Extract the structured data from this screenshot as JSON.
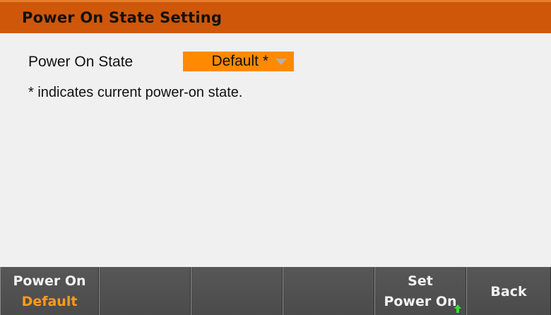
{
  "header": {
    "title": "Power On State Setting"
  },
  "form": {
    "label": "Power On State",
    "selected_value": "Default *",
    "note": "* indicates current power-on state."
  },
  "softkeys": [
    {
      "line1": "Power On",
      "line2": "Default"
    },
    {
      "line1": "",
      "line2": ""
    },
    {
      "line1": "",
      "line2": ""
    },
    {
      "line1": "",
      "line2": ""
    },
    {
      "line1": "Set",
      "line2": "Power On"
    },
    {
      "label": "Back"
    }
  ],
  "colors": {
    "title_bar": "#cf5709",
    "dropdown": "#ff8a00",
    "accent_text": "#ff9b1a",
    "softkey_bg": "#4f4f4f",
    "arrow_indicator": "#33dd33"
  },
  "icons": {
    "dropdown": "chevron-down-icon",
    "set_power_on_indicator": "up-arrow-icon"
  }
}
